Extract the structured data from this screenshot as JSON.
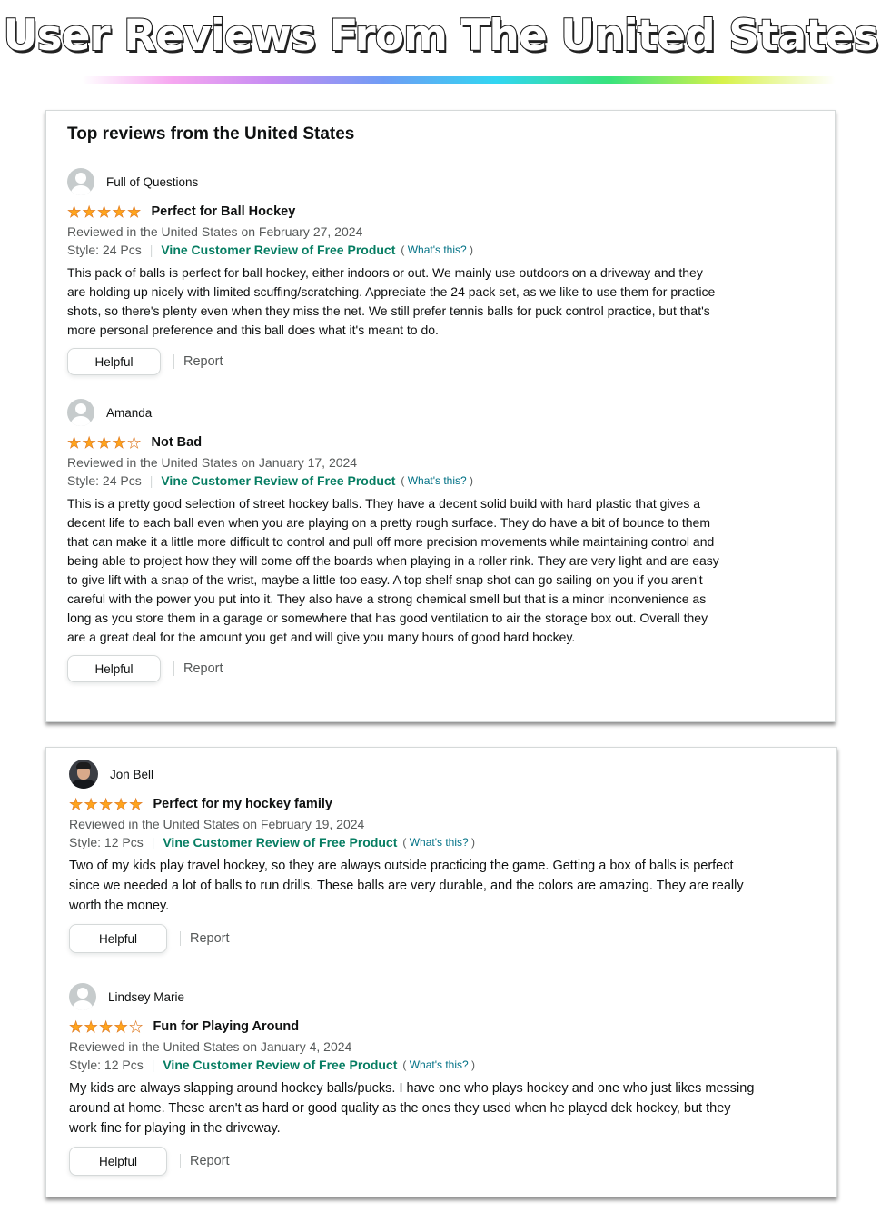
{
  "banner": {
    "title": "User Reviews From The United States"
  },
  "sections": [
    {
      "title": "Top reviews from the United States",
      "reviews": [
        {
          "name": "Full of Questions",
          "rating": 5,
          "title": "Perfect for Ball Hockey",
          "meta": "Reviewed in the United States on February 27, 2024",
          "style": "Style: 24 Pcs",
          "vine": "Vine Customer Review of Free Product",
          "whats": "What's this?",
          "body": "This pack of balls is perfect for ball hockey, either indoors or out. We mainly use outdoors on a driveway and they are holding up nicely with limited scuffing/scratching. Appreciate the 24 pack set, as we like to use them for practice shots, so there's plenty even when they miss the net. We still prefer tennis balls for puck control practice, but that's more personal preference and this ball does what it's meant to do.",
          "helpful": "Helpful",
          "report": "Report"
        },
        {
          "name": "Amanda",
          "rating": 4,
          "title": "Not Bad",
          "meta": "Reviewed in the United States on January 17, 2024",
          "style": "Style: 24 Pcs",
          "vine": "Vine Customer Review of Free Product",
          "whats": "What's this?",
          "body": "This is a pretty good selection of street hockey balls. They have a decent solid build with hard plastic that gives a decent life to each ball even when you are playing on a pretty rough surface. They do have a bit of bounce to them that can make it a little more difficult to control and pull off more precision movements while maintaining control and being able to project how they will come off the boards when playing in a roller rink. They are very light and are easy to give lift with a snap of the wrist, maybe a little too easy. A top shelf snap shot can go sailing on you if you aren't careful with the power you put into it. They also have a strong chemical smell but that is a minor inconvenience as long as you store them in a garage or somewhere that has good ventilation to air the storage box out. Overall they are a great deal for the amount you get and will give you many hours of good hard hockey.",
          "helpful": "Helpful",
          "report": "Report"
        }
      ]
    },
    {
      "reviews": [
        {
          "name": "Jon Bell",
          "rating": 5,
          "title": "Perfect for my hockey family",
          "meta": "Reviewed in the United States on February 19, 2024",
          "style": "Style: 12 Pcs",
          "vine": "Vine Customer Review of Free Product",
          "whats": "What's this?",
          "body": "Two of my kids play travel hockey, so they are always outside practicing the game. Getting a box of balls is perfect since we needed a lot of balls to run drills. These balls are very durable, and the colors are amazing. They are really worth the money.",
          "helpful": "Helpful",
          "report": "Report"
        },
        {
          "name": "Lindsey Marie",
          "rating": 4,
          "title": "Fun for Playing Around",
          "meta": "Reviewed in the United States on January 4, 2024",
          "style": "Style: 12 Pcs",
          "vine": "Vine Customer Review of Free Product",
          "whats": "What's this?",
          "body": "My kids are always slapping around hockey balls/pucks. I have one who plays hockey and one who just likes messing around at home. These aren't as hard or good quality as the ones they used when he played dek hockey, but they work fine for playing in the driveway.",
          "helpful": "Helpful",
          "report": "Report"
        }
      ]
    }
  ],
  "colors": {
    "star": "#ffa41c",
    "vine": "#067d62",
    "link": "#007185",
    "meta": "#565959"
  },
  "icons": {
    "avatar_default": "user-silhouette-icon",
    "star": "star-icon"
  }
}
